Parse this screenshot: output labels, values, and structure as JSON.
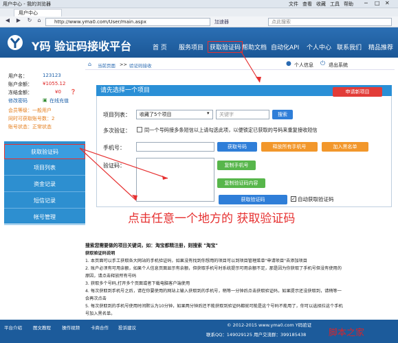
{
  "browser": {
    "title": "用户中心 - 我的浏览器",
    "menu": [
      "文件",
      "查看",
      "收藏",
      "工具",
      "帮助"
    ],
    "tab_label": "用户中心",
    "url": "http://www.yma0.com/User/main.aspx",
    "url_hint": "加速器",
    "search_placeholder": "点此搜索"
  },
  "header": {
    "logo": "Y码 验证码接收平台",
    "nav": [
      "首 页",
      "服务项目",
      "获取验证码",
      "帮助文档",
      "自动化API",
      "个人中心",
      "联系我们",
      "精品推荐"
    ]
  },
  "breadcrumb": {
    "items": [
      "当前页面",
      ">>",
      "验证码接收"
    ],
    "personal": "个人信息",
    "logout": "退出系统"
  },
  "user": {
    "name_label": "用户名：",
    "name": "123123",
    "balance_label": "账户余额：",
    "balance": "¥1055.12",
    "frozen_label": "冻结金额：",
    "frozen": "¥0",
    "change_pwd": "修改密码",
    "recharge": "在线充值",
    "level": "会员等级：一般用户",
    "count": "同时可获取账号数：2",
    "status": "账号状态：正常状态"
  },
  "sidebar": {
    "items": [
      "获取验证码",
      "项目列表",
      "资金记录",
      "短信记录",
      "帐号管理"
    ]
  },
  "panel": {
    "title": "请先选择一个项目",
    "new_project": "申请新项目",
    "project_label": "项目列表：",
    "project_select": "收藏了5个项目",
    "keyword_placeholder": "关键字",
    "search_btn": "搜索",
    "multi_label": "多次验证：",
    "multi_text": "同一个号码接多条短信以上请勾选此项，以便锁定已获取的号码来重复接收短信",
    "phone_label": "手机号：",
    "get_number": "获取号码",
    "release_all": "释放所有手机号",
    "add_blacklist": "加入黑名单",
    "code_label": "验证码：",
    "copy_phone": "复制手机号",
    "copy_code": "复制验证码内容",
    "get_code": "获取验证码",
    "auto_get": "自动获取验证码"
  },
  "annotation": "点击任意一个地方的 获取验证码",
  "instructions": {
    "headline": "搜索您需要做的项目关键词，如：淘宝都精注册，则搜索 \"淘宝\"",
    "title": "获取验证码说明",
    "lines": [
      "1. 本页面可以手工获取各大网站的手机验证码，如果没有找到你想用的项目可以到项目管理菜单\"申请项目\"去添加项目",
      "2. 账户必须有可用余额，如果个人信息页面显示有余额，但获取手机号时系统提示可用余额不足，那是因为你获取了手机号但没有使用的",
      "原因，请点击释放所有号码",
      "3. 获取多个号码,打开多个页面或者下载电脑客户端使用",
      "4. 每次获取到手机号之后，请在你要使用的网站上输入获取到的手机号，稍等一分钟后点击获取验证码，如果提示还没获取到，请稍等一",
      "会再次点击",
      "5. 每次获取到的手机号使用时间默认为10分钟，如果两分钟后还不能获取到验证码都就可能是这个号码不能用了，你可以选择拉这个手机",
      "号加入黑名单。"
    ]
  },
  "footer": {
    "links": [
      "平台介绍",
      "图文教程",
      "操作视频",
      "卡商合作",
      "投诉建议"
    ],
    "copyright": "© 2012-2015 www.yma0.com Y码验证",
    "contact": "联系QQ：149029125 用户交流群：399185438"
  },
  "watermark": "脚本之家",
  "colors": {
    "header": "#1b5796",
    "menu": "#2d8fd0",
    "annotation": "#e63030"
  }
}
